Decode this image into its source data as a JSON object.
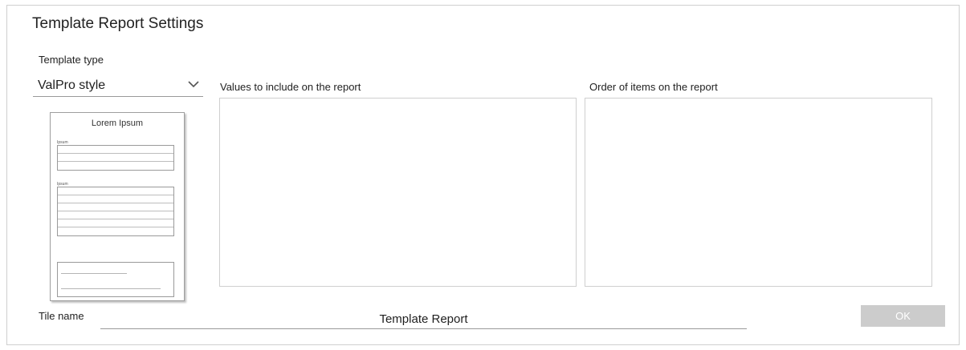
{
  "dialog": {
    "title": "Template Report Settings"
  },
  "template_type": {
    "label": "Template type",
    "selected": "ValPro style"
  },
  "preview": {
    "title": "Lorem Ipsum",
    "section1_label": "Ipsum",
    "section2_label": "Ipsum"
  },
  "values_list": {
    "label": "Values to include on the report",
    "items": []
  },
  "order_list": {
    "label": "Order of items on the report",
    "items": []
  },
  "tile_name": {
    "label": "Tile name",
    "value": "Template Report"
  },
  "buttons": {
    "ok": "OK",
    "ok_enabled": false
  },
  "colors": {
    "panel_border": "#cfcfcf",
    "ok_disabled_bg": "#cccccc",
    "ok_disabled_text": "#ffffff"
  }
}
